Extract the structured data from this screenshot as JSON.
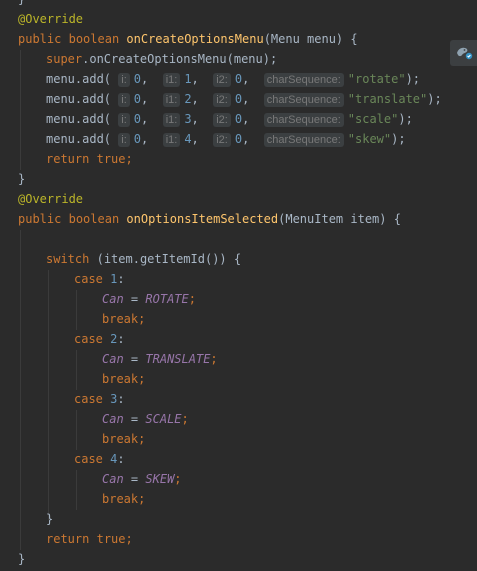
{
  "code": {
    "brace_top": "}",
    "ann1": "@Override",
    "kw_public": "public",
    "kw_boolean": "boolean",
    "m1_name": "onCreateOptionsMenu",
    "m1_params": "(Menu menu) {",
    "kw_super": "super",
    "super_call": ".onCreateOptionsMenu(menu);",
    "add_call": "menu.add(",
    "hint_i": "i:",
    "hint_i1": "i1:",
    "hint_i2": "i2:",
    "hint_cs": "charSequence:",
    "zero": "0",
    "comma": ",",
    "close": ");",
    "items": [
      {
        "i1": "1",
        "text": "\"rotate\""
      },
      {
        "i1": "2",
        "text": "\"translate\""
      },
      {
        "i1": "3",
        "text": "\"scale\""
      },
      {
        "i1": "4",
        "text": "\"skew\""
      }
    ],
    "kw_return": "return",
    "kw_true": "true",
    "semi": ";",
    "brace_close": "}",
    "ann2": "@Override",
    "m2_name": "onOptionsItemSelected",
    "m2_params": "(MenuItem item) {",
    "kw_switch": "switch",
    "switch_expr": "(item.getItemId()) {",
    "kw_case": "case",
    "var_can": "Can",
    "assign": "=",
    "kw_break": "break",
    "cases": [
      {
        "num": "1",
        "const": "ROTATE"
      },
      {
        "num": "2",
        "const": "TRANSLATE"
      },
      {
        "num": "3",
        "const": "SCALE"
      },
      {
        "num": "4",
        "const": "SKEW"
      }
    ],
    "colon": ":"
  },
  "floating_button": {
    "icon": "plugin-assistant-icon"
  }
}
